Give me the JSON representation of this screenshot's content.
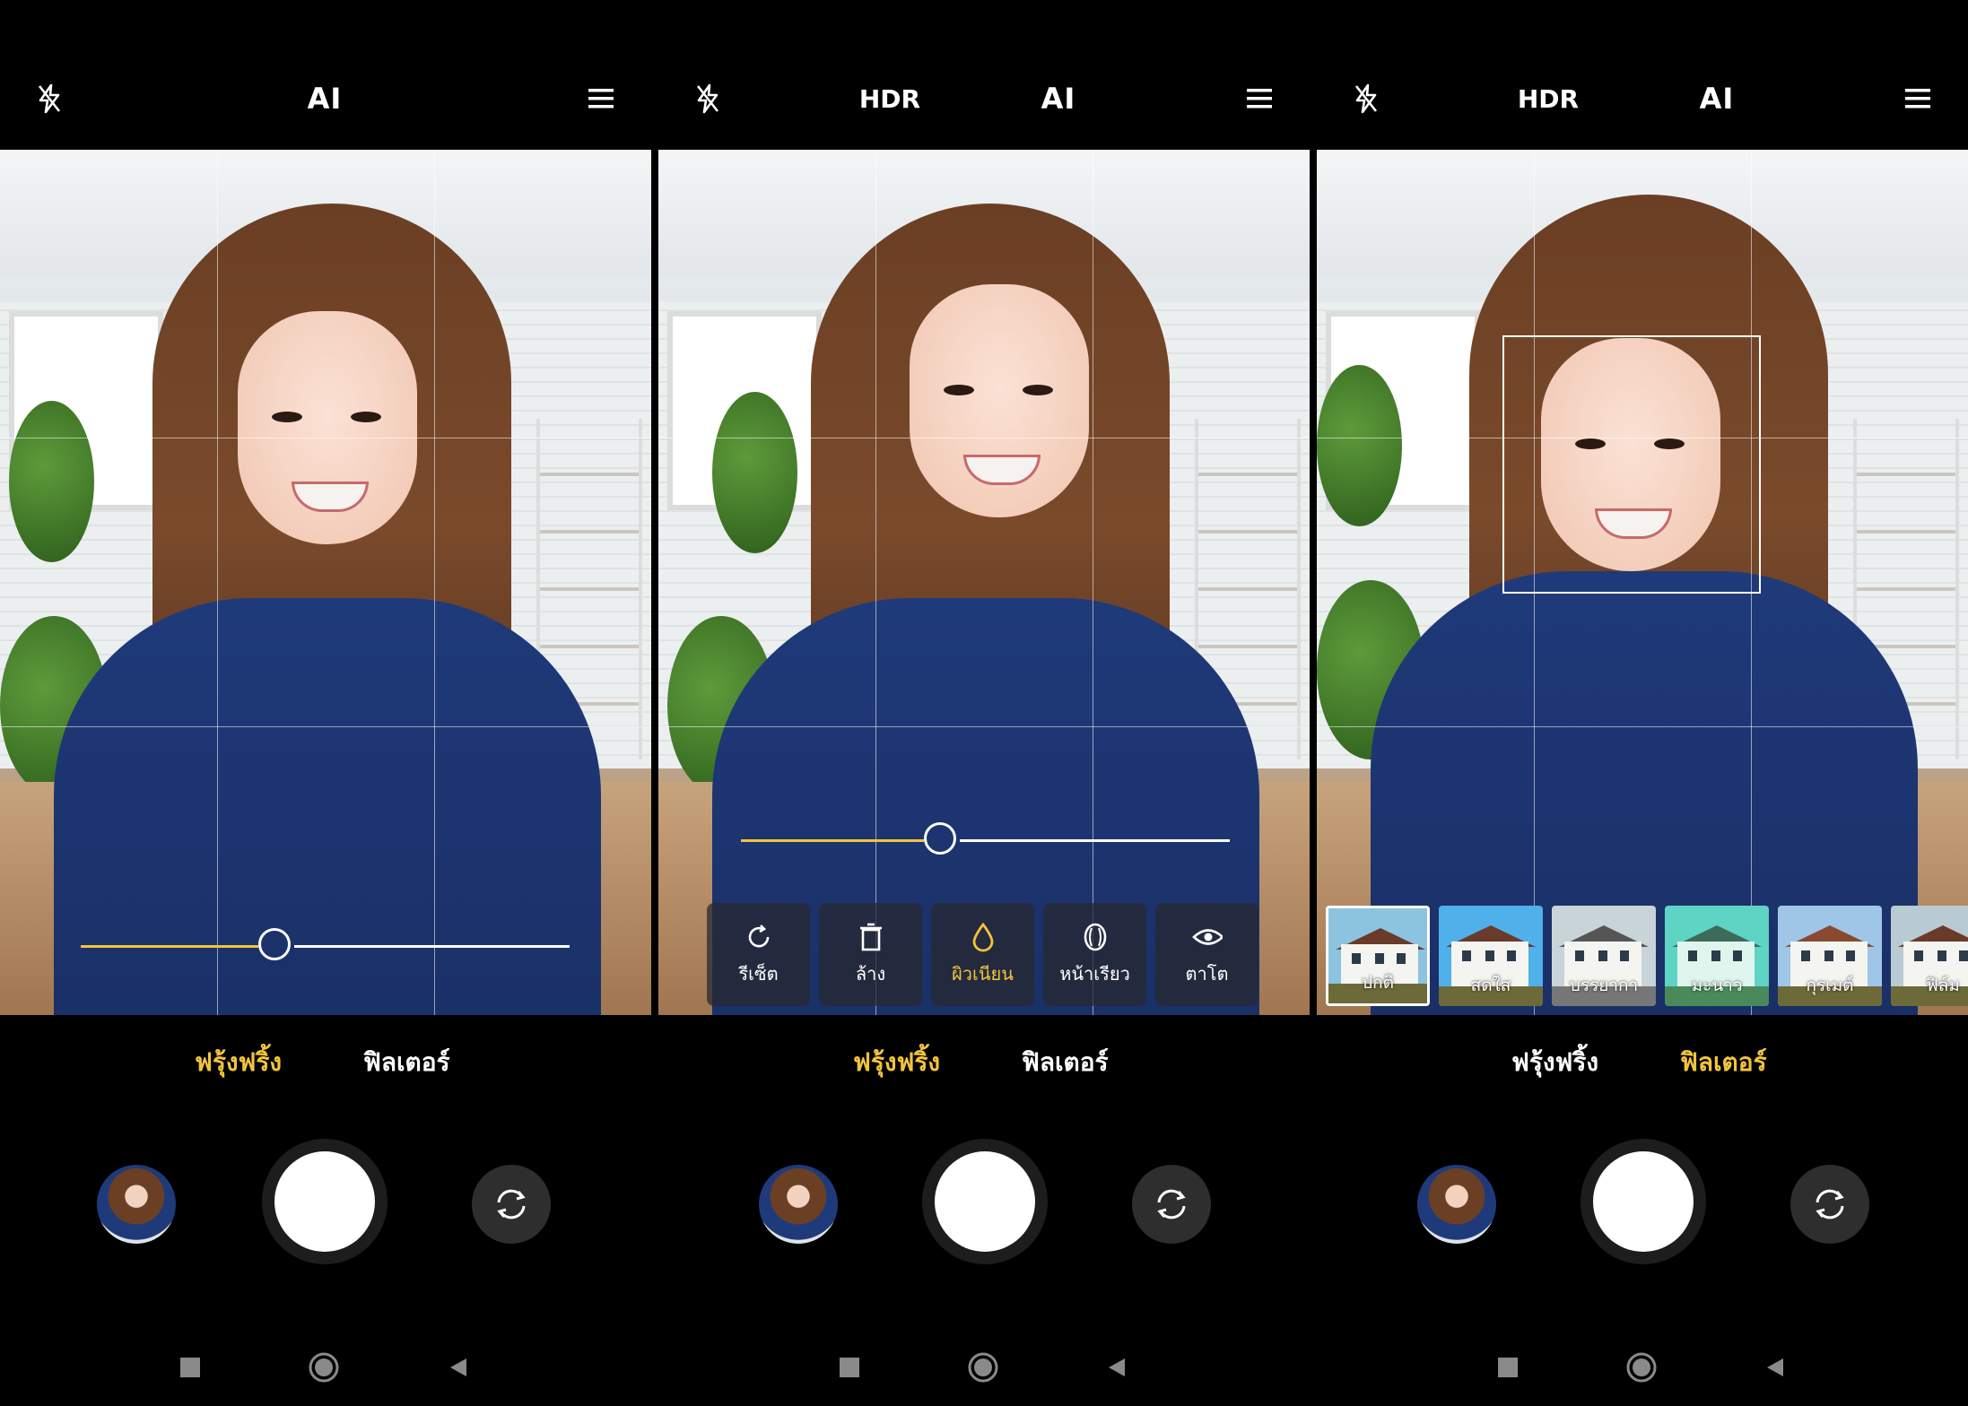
{
  "panels": [
    {
      "topbar": {
        "flash_icon": "flash-off-icon",
        "ai_label": "AI",
        "menu_icon": "menu-icon"
      },
      "modes": {
        "beauty": "ฟรุ้งฟริ้ง",
        "filter": "ฟิลเตอร์",
        "active": "beauty"
      },
      "slider": {
        "value": 0.41
      }
    },
    {
      "topbar": {
        "flash_icon": "flash-off-icon",
        "hdr_label": "HDR",
        "ai_label": "AI",
        "menu_icon": "menu-icon"
      },
      "beauty_tools": [
        {
          "label": "รีเซ็ต",
          "icon": "reset-icon"
        },
        {
          "label": "ล้าง",
          "icon": "trash-icon"
        },
        {
          "label": "ผิวเนียน",
          "icon": "droplet-icon",
          "active": true
        },
        {
          "label": "หน้าเรียว",
          "icon": "face-slim-icon"
        },
        {
          "label": "ตาโต",
          "icon": "eye-icon"
        }
      ],
      "modes": {
        "beauty": "ฟรุ้งฟริ้ง",
        "filter": "ฟิลเตอร์",
        "active": "beauty"
      },
      "slider": {
        "value": 0.41
      }
    },
    {
      "topbar": {
        "flash_icon": "flash-off-icon",
        "hdr_label": "HDR",
        "ai_label": "AI",
        "menu_icon": "menu-icon"
      },
      "filters": [
        {
          "label": "ปกติ",
          "selected": true,
          "sky": "#8cc3df"
        },
        {
          "label": "สดใส",
          "sky": "#4fb0ea"
        },
        {
          "label": "บรรยากา",
          "sky": "#c8d4d8"
        },
        {
          "label": "มะนาว",
          "sky": "#5fd4c4"
        },
        {
          "label": "กุรเมต์",
          "sky": "#9fc6e6"
        },
        {
          "label": "ฟิล์ม",
          "sky": "#b8cbd3"
        }
      ],
      "modes": {
        "beauty": "ฟรุ้งฟริ้ง",
        "filter": "ฟิลเตอร์",
        "active": "filter"
      }
    }
  ],
  "controls": {
    "gallery_icon": "gallery-thumbnail",
    "shutter_icon": "shutter-button",
    "switch_icon": "switch-camera-icon"
  },
  "navbar": {
    "recents_icon": "recents-icon",
    "home_icon": "home-icon",
    "back_icon": "back-icon"
  },
  "colors": {
    "accent": "#f3c43a",
    "background": "#000000"
  }
}
